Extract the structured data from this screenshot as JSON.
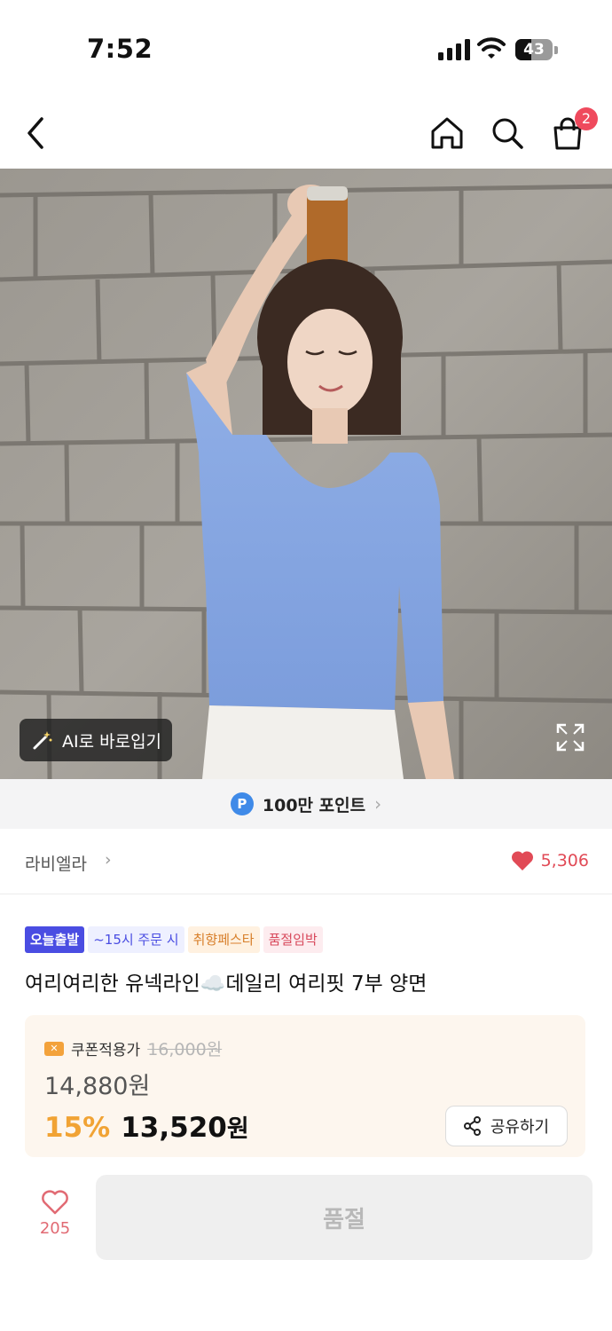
{
  "status_bar": {
    "time": "7:52",
    "battery": "43",
    "battery_level": 0.43
  },
  "nav": {
    "icons": [
      "back-arrow-icon",
      "home-icon",
      "search-icon",
      "shopping-bag-icon"
    ],
    "cart_count": "2"
  },
  "hero": {
    "ai_tryon_label": "AI로 바로입기",
    "icons": [
      "magic-wand-icon",
      "expand-icon"
    ]
  },
  "points": {
    "badge": "P",
    "label": "100만 포인트",
    "chevron": "›"
  },
  "brand": {
    "name": "라비엘라",
    "chevron": "›",
    "likes": "5,306"
  },
  "tags": [
    "오늘출발",
    "~15시 주문 시",
    "취향페스타",
    "품절임박"
  ],
  "product": {
    "title": "여리여리한 유넥라인☁️데일리 여리핏 7부 양면"
  },
  "price": {
    "coupon_icon_text": "✕",
    "coupon_label": "쿠폰적용가",
    "original": "16,000원",
    "intermediate": "14,880원",
    "discount": "15%",
    "final_number": "13,520",
    "final_unit": "원",
    "share_label": "공유하기"
  },
  "bottom": {
    "wish_count": "205",
    "soldout_label": "품절"
  },
  "colors": {
    "accent_red": "#ef4a5d",
    "discount_orange": "#f1a334",
    "tag_blue": "#4a4de2",
    "point_blue": "#3f8ae8"
  }
}
